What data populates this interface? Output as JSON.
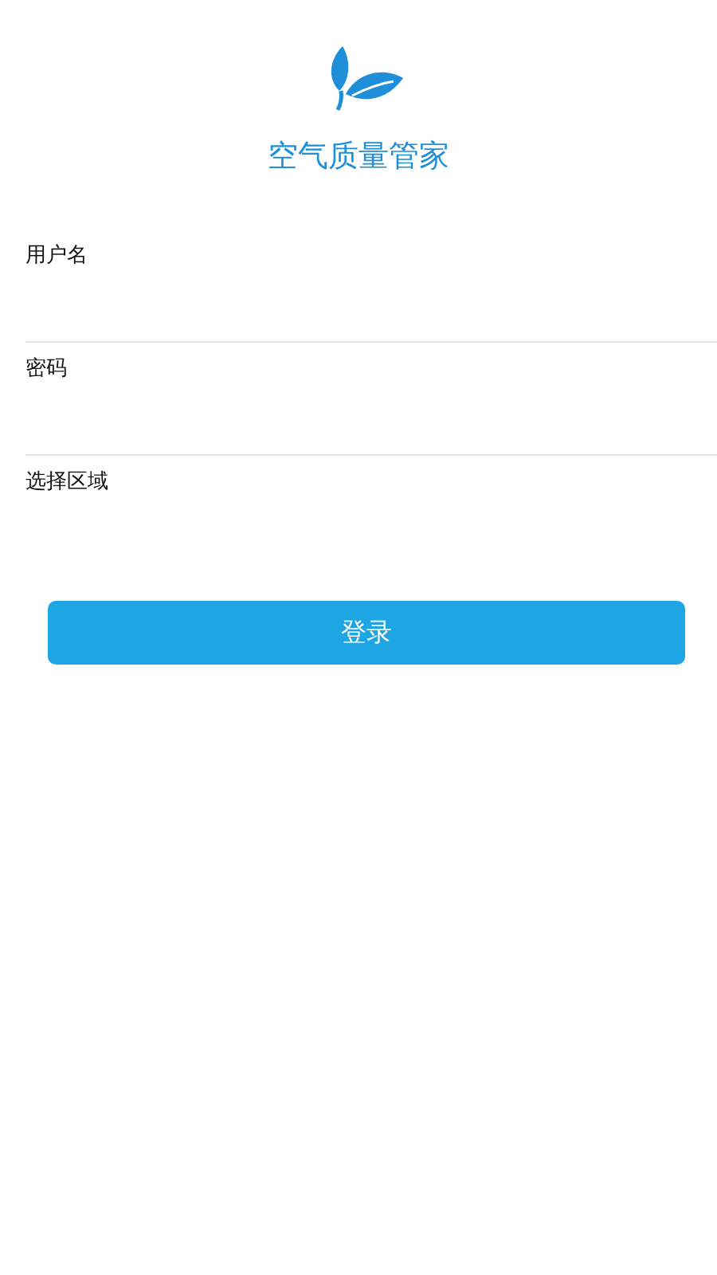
{
  "app": {
    "title": "空气质量管家"
  },
  "fields": [
    {
      "label": "用户名",
      "kind": "text"
    },
    {
      "label": "密码",
      "kind": "password"
    },
    {
      "label": "选择区域",
      "kind": "select"
    }
  ],
  "login_button": {
    "label": "登录"
  }
}
